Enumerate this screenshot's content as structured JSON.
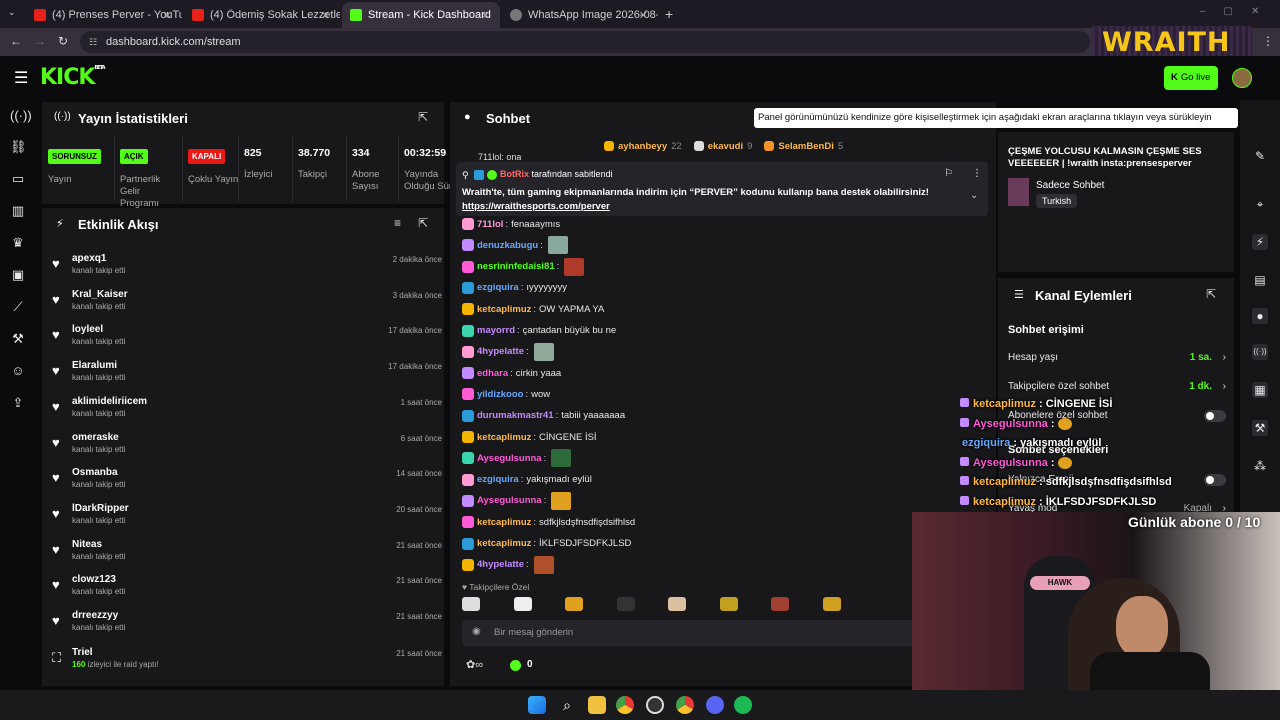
{
  "browser": {
    "tabs": [
      {
        "label": "(4) Prenses Perver - YouTube",
        "active": false,
        "favicon": "youtube-icon"
      },
      {
        "label": "(4) Ödemiş Sokak Lezzetleri | -",
        "active": false,
        "favicon": "youtube-icon"
      },
      {
        "label": "Stream - Kick Dashboard",
        "active": true,
        "favicon": "kick-icon"
      },
      {
        "label": "WhatsApp Image 2026-08-08 a",
        "active": false,
        "favicon": "globe-icon"
      }
    ],
    "url": "dashboard.kick.com/stream"
  },
  "header": {
    "logo": "KICK",
    "logo_sup": "BETA",
    "go_live": "Go live",
    "sponsor": "WRAITH"
  },
  "stats": {
    "title": "Yayın İstatistikleri",
    "items": [
      {
        "badge": "SORUNSUZ",
        "badge_color": "#53fc18",
        "label": "Yayın"
      },
      {
        "badge": "AÇIK",
        "badge_color": "#53fc18",
        "label": "Partnerlik Gelir Programı"
      },
      {
        "badge": "KAPALI",
        "badge_color": "#e91916",
        "label": "Çoklu Yayın"
      },
      {
        "value": "825",
        "label": "İzleyici"
      },
      {
        "value": "38.770",
        "label": "Takipçi"
      },
      {
        "value": "334",
        "label": "Abone Sayısı"
      },
      {
        "value": "00:32:59",
        "label": "Yayında Olduğu Süre"
      }
    ]
  },
  "activity": {
    "title": "Etkinlik Akışı",
    "items": [
      {
        "name": "apexq1",
        "sub": "kanalı takip etti",
        "time": "2 dakika önce"
      },
      {
        "name": "Kral_Kaiser",
        "sub": "kanalı takip etti",
        "time": "3 dakika önce"
      },
      {
        "name": "loyleel",
        "sub": "kanalı takip etti",
        "time": "17 dakika önce"
      },
      {
        "name": "Elaralumi",
        "sub": "kanalı takip etti",
        "time": "17 dakika önce"
      },
      {
        "name": "aklimideliriicem",
        "sub": "kanalı takip etti",
        "time": "1 saat önce"
      },
      {
        "name": "omeraske",
        "sub": "kanalı takip etti",
        "time": "6 saat önce"
      },
      {
        "name": "Osmanba",
        "sub": "kanalı takip etti",
        "time": "14 saat önce"
      },
      {
        "name": "lDarkRipper",
        "sub": "kanalı takip etti",
        "time": "20 saat önce"
      },
      {
        "name": "Niteas",
        "sub": "kanalı takip etti",
        "time": "21 saat önce"
      },
      {
        "name": "clowz123",
        "sub": "kanalı takip etti",
        "time": "21 saat önce"
      },
      {
        "name": "drreezzyy",
        "sub": "kanalı takip etti",
        "time": "21 saat önce"
      }
    ],
    "raid": {
      "name": "Triel",
      "count": "160",
      "sub": "izleyici ile raid yaptı!",
      "time": "21 saat önce"
    }
  },
  "chat": {
    "title": "Sohbet",
    "tooltip": "Panel görünümünüzü kendinize göre kişiselleştirmek için aşağıdaki ekran araçlarına tıklayın veya sürükleyin",
    "top_gifters": [
      {
        "name": "ayhanbeyy",
        "count": "22"
      },
      {
        "name": "ekavudi",
        "count": "9"
      },
      {
        "name": "SelamBenDi",
        "count": "5"
      }
    ],
    "partial_top": "711lol: ona",
    "pinned": {
      "by": "BotRix",
      "by_suffix": "tarafından sabitlendi",
      "text": "Wraith'te, tüm gaming ekipmanlarında indirim için “PERVER” kodunu kullanıp bana destek olabilirsiniz!",
      "link": "https://wraithesports.com/perver"
    },
    "messages": [
      {
        "user": "711lol",
        "color": "#ff9bd2",
        "text": "fenaaaymıs",
        "emote": ""
      },
      {
        "user": "denuzkabugu",
        "color": "#6aa8ff",
        "text": "",
        "emote": "#88a8a0"
      },
      {
        "user": "nesrininfedaisi81",
        "color": "#53fc18",
        "text": "",
        "emote": "#b03a2a"
      },
      {
        "user": "ezgiquira",
        "color": "#6aa8ff",
        "text": "ıyyyyyyyy",
        "emote": ""
      },
      {
        "user": "ketcaplimuz",
        "color": "#ffb84d",
        "text": "OW YAPMA YA",
        "emote": ""
      },
      {
        "user": "mayorrd",
        "color": "#c38bff",
        "text": "çantadan büyük bu ne",
        "emote": ""
      },
      {
        "user": "4hypelatte",
        "color": "#c38bff",
        "text": "",
        "emote": "#8fa89a"
      },
      {
        "user": "edhara",
        "color": "#ff5bd6",
        "text": "cirkin yaaa",
        "emote": ""
      },
      {
        "user": "yildizkooo",
        "color": "#6aa8ff",
        "text": "wow",
        "emote": ""
      },
      {
        "user": "durumakmastr41",
        "color": "#c38bff",
        "text": "tabiii yaaaaaaa",
        "emote": ""
      },
      {
        "user": "ketcaplimuz",
        "color": "#ffb84d",
        "text": "CİNGENE İSİ",
        "emote": ""
      },
      {
        "user": "Aysegulsunna",
        "color": "#ff5bd6",
        "text": "",
        "emote": "#2e6b3a"
      },
      {
        "user": "ezgiquira",
        "color": "#6aa8ff",
        "text": "yakışmadı eylül",
        "emote": ""
      },
      {
        "user": "Aysegulsunna",
        "color": "#ff5bd6",
        "text": "",
        "emote": "#e0a020"
      },
      {
        "user": "ketcaplimuz",
        "color": "#ffb84d",
        "text": "sdfkjlsdşfnsdfişdsifhlsd",
        "emote": ""
      },
      {
        "user": "ketcaplimuz",
        "color": "#ffb84d",
        "text": "İKLFSDJFSDFKJLSD",
        "emote": ""
      },
      {
        "user": "4hypelatte",
        "color": "#c38bff",
        "text": "",
        "emote": "#b0502a"
      }
    ],
    "followers_only": "Takipçilere Özel",
    "input_placeholder": "Bir mesaj gönderin",
    "points": "0"
  },
  "stream_info": {
    "title": "ÇEŞME YOLCUSU KALMASIN ÇEŞME SES VEEEEEER | !wraith insta:prensesperver",
    "category": "Sadece Sohbet",
    "tag": "Turkish"
  },
  "channel_actions": {
    "title": "Kanal Eylemleri",
    "section": "Sohbet erişimi",
    "rows": [
      {
        "label": "Hesap yaşı",
        "value": "1 sa."
      },
      {
        "label": "Takipçilere özel sohbet",
        "value": "1 dk."
      },
      {
        "label": "Abonelere özel sohbet",
        "value": ""
      }
    ],
    "section2": "Sohbet seçenekleri",
    "rows2": [
      {
        "label": "Yalnızca Emoji",
        "value": ""
      },
      {
        "label": "Yavaş mod",
        "value": "Kapalı"
      }
    ]
  },
  "overlay": {
    "messages": [
      {
        "user": "ketcaplimuz",
        "text": "CİNGENE İSİ",
        "color": "#ffb84d"
      },
      {
        "user": "Aysegulsunna",
        "text": "",
        "color": "#ff5bd6"
      },
      {
        "user": "ezgiquira",
        "text": "yakışmadı eylül",
        "color": "#6aa8ff"
      },
      {
        "user": "Aysegulsunna",
        "text": "",
        "color": "#ff5bd6"
      },
      {
        "user": "ketcaplimuz",
        "text": "sdfkjlsdşfnsdfişdsifhlsd",
        "color": "#ffb84d"
      },
      {
        "user": "ketcaplimuz",
        "text": "İKLFSDJFSDFKJLSD",
        "color": "#ffb84d"
      }
    ],
    "sub_goal": "Günlük abone 0 / 10",
    "chair_brand": "HAWK"
  },
  "colors": {
    "kick_green": "#53fc18",
    "panel": "#18181b",
    "background": "#0b0b0d"
  }
}
